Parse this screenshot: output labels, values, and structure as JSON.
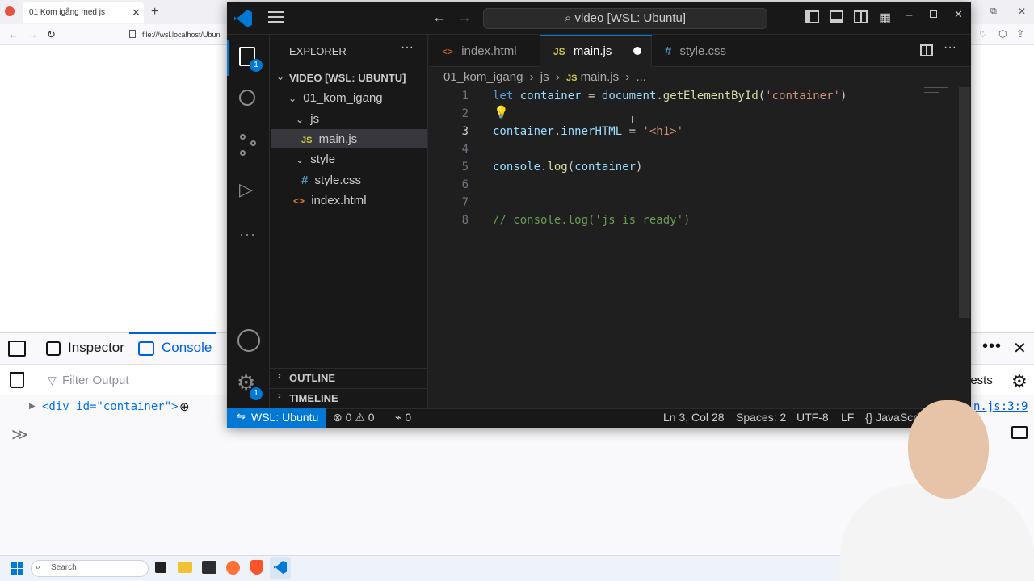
{
  "browser": {
    "tab_title": "01 Kom igång med js",
    "url": "file:///wsl.localhost/Ubun"
  },
  "devtools": {
    "tabs": [
      "Inspector",
      "Console"
    ],
    "filter_placeholder": "Filter Output",
    "console_output": "<div id=\"container\">",
    "requests_label": "uests",
    "source_link": "n.js:3:9"
  },
  "taskbar": {
    "search_placeholder": "Search"
  },
  "vscode": {
    "command_center": "video [WSL: Ubuntu]",
    "explorer": {
      "title": "EXPLORER",
      "root": "VIDEO [WSL: UBUNTU]",
      "tree": [
        {
          "label": "01_kom_igang",
          "type": "folder"
        },
        {
          "label": "js",
          "type": "folder"
        },
        {
          "label": "main.js",
          "type": "js"
        },
        {
          "label": "style",
          "type": "folder"
        },
        {
          "label": "style.css",
          "type": "css"
        },
        {
          "label": "index.html",
          "type": "html"
        }
      ],
      "outline": "OUTLINE",
      "timeline": "TIMELINE"
    },
    "activity_badges": {
      "explorer": "1",
      "settings": "1"
    },
    "tabs": [
      {
        "label": "index.html",
        "icon": "<>"
      },
      {
        "label": "main.js",
        "icon": "JS"
      },
      {
        "label": "style.css",
        "icon": "#"
      }
    ],
    "breadcrumb": {
      "folder": "01_kom_igang",
      "sub": "js",
      "file": "main.js",
      "more": "..."
    },
    "code_lines": [
      {
        "n": "1"
      },
      {
        "n": "2"
      },
      {
        "n": "3"
      },
      {
        "n": "4"
      },
      {
        "n": "5"
      },
      {
        "n": "6"
      },
      {
        "n": "7"
      },
      {
        "n": "8"
      }
    ],
    "code": {
      "l1_kw": "let",
      "l1_var": "container",
      "l1_eq": " = ",
      "l1_obj": "document",
      "l1_dot": ".",
      "l1_fn": "getElementById",
      "l1_p1": "(",
      "l1_str": "'container'",
      "l1_p2": ")",
      "l3_var": "container",
      "l3_dot": ".",
      "l3_prop": "innerHTML",
      "l3_eq": " = ",
      "l3_str": "'<h1>'",
      "l5_obj": "console",
      "l5_dot": ".",
      "l5_fn": "log",
      "l5_p1": "(",
      "l5_var": "container",
      "l5_p2": ")",
      "l8_cmt": "// console.log('js is ready')"
    },
    "status": {
      "remote": "WSL: Ubuntu",
      "errors": "0",
      "warnings": "0",
      "ports": "0",
      "position": "Ln 3, Col 28",
      "spaces": "Spaces: 2",
      "encoding": "UTF-8",
      "eol": "LF",
      "language": "JavaScri"
    }
  },
  "colors": {
    "accent": "#0078d4",
    "editor_bg": "#1f1f1f",
    "firefox_blue": "#0061e0"
  }
}
